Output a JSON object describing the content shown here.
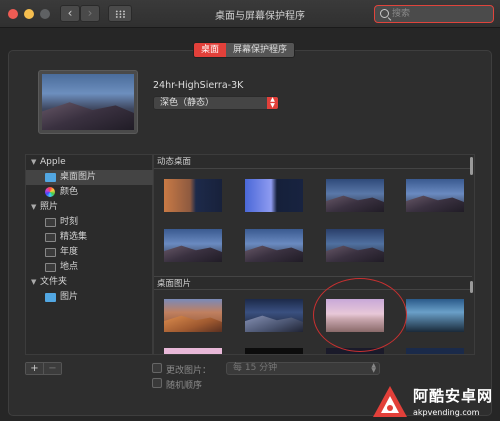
{
  "window": {
    "title": "桌面与屏幕保护程序",
    "search_placeholder": "搜索",
    "search_value": ""
  },
  "tabs": [
    {
      "label": "桌面",
      "active": true
    },
    {
      "label": "屏幕保护程序",
      "active": false
    }
  ],
  "current": {
    "name": "24hr-HighSierra-3K",
    "mode": "深色（静态）"
  },
  "sidebar": {
    "groups": [
      {
        "label": "Apple",
        "items": [
          {
            "label": "桌面图片",
            "icon": "folder-blue-icon",
            "selected": true
          },
          {
            "label": "颜色",
            "icon": "color-wheel-icon",
            "selected": false
          }
        ]
      },
      {
        "label": "照片",
        "items": [
          {
            "label": "时刻",
            "icon": "folder-icon"
          },
          {
            "label": "精选集",
            "icon": "folder-icon"
          },
          {
            "label": "年度",
            "icon": "folder-icon"
          },
          {
            "label": "地点",
            "icon": "folder-icon"
          }
        ]
      },
      {
        "label": "文件夹",
        "items": [
          {
            "label": "图片",
            "icon": "folder-blue-icon"
          }
        ]
      }
    ]
  },
  "sections": {
    "dynamic": "动态桌面",
    "pictures": "桌面图片"
  },
  "bottom": {
    "add": "+",
    "remove": "−",
    "change_picture": "更改图片：",
    "interval": "每 15 分钟",
    "random_order": "随机顺序"
  },
  "watermark": {
    "title": "阿酷安卓网",
    "url": "akpvending.com"
  },
  "colors": {
    "accent": "#e2403a",
    "selection": "#444444",
    "folder_blue": "#52a7e2"
  }
}
